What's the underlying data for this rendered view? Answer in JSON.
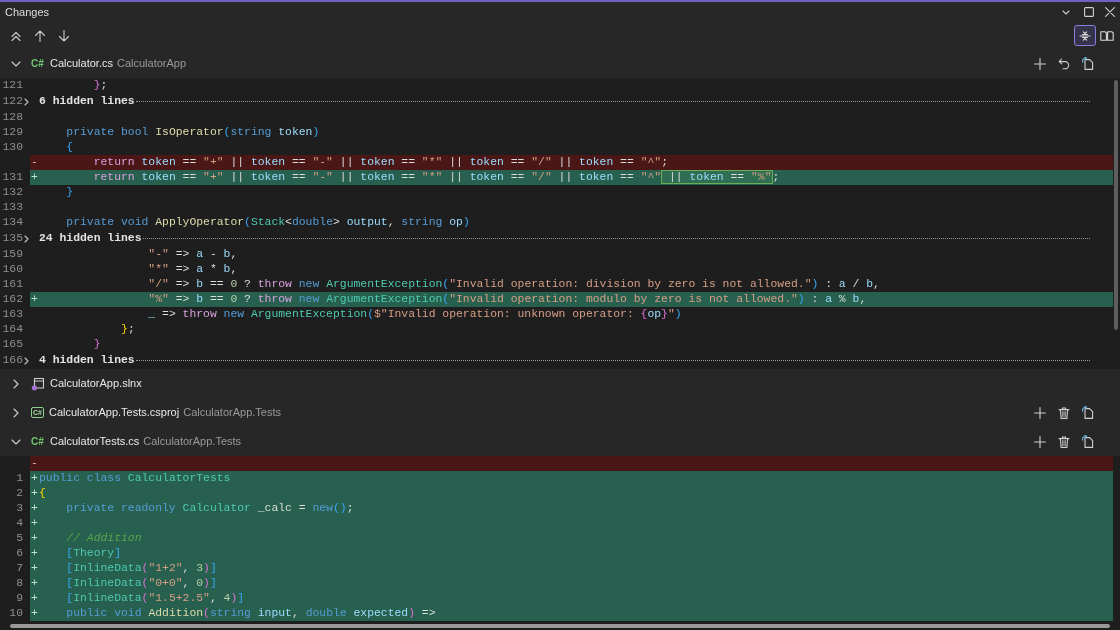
{
  "window": {
    "title": "Changes",
    "buttons": [
      {
        "kind": "dropdown"
      },
      {
        "kind": "maximize"
      },
      {
        "kind": "close"
      }
    ]
  },
  "toolbar": {
    "buttons": [
      {
        "kind": "first"
      },
      {
        "kind": "previous"
      },
      {
        "kind": "next"
      }
    ],
    "views": [
      {
        "kind": "inline",
        "selected": true
      },
      {
        "kind": "side-by-side",
        "selected": false
      }
    ]
  },
  "files": [
    {
      "name": "Calculator.cs",
      "project": "CalculatorApp",
      "icon": {
        "kind": "csharp",
        "text": "C#"
      },
      "expanded": true,
      "actions": [
        {
          "kind": "plus"
        },
        {
          "kind": "undo"
        },
        {
          "kind": "document"
        }
      ],
      "lines": [
        {
          "kind": "context",
          "number": "121",
          "tokens": [
            {
              "text": "        }",
              "kind": "brace2"
            },
            {
              "text": ";",
              "kind": "plain"
            }
          ]
        },
        {
          "kind": "hidden",
          "number": "122",
          "label": "6 hidden lines"
        },
        {
          "kind": "context",
          "number": "128"
        },
        {
          "kind": "context",
          "number": "129",
          "tokens": [
            {
              "text": "    private bool",
              "kind": "keyword"
            },
            {
              "text": " IsOperator",
              "kind": "method"
            },
            {
              "text": "(",
              "kind": "brace3"
            },
            {
              "text": "string",
              "kind": "keyword"
            },
            {
              "text": " token",
              "kind": "param"
            },
            {
              "text": ")",
              "kind": "brace3"
            }
          ]
        },
        {
          "kind": "context",
          "number": "130",
          "tokens": [
            {
              "text": "    {",
              "kind": "brace3"
            }
          ]
        },
        {
          "kind": "removed",
          "marker": "-",
          "tokens": [
            {
              "text": "        return",
              "kind": "control"
            },
            {
              "text": " token",
              "kind": "param"
            },
            {
              "text": " == ",
              "kind": "plain"
            },
            {
              "text": "\"+\"",
              "kind": "string"
            },
            {
              "text": " || ",
              "kind": "plain"
            },
            {
              "text": "token",
              "kind": "param"
            },
            {
              "text": " == ",
              "kind": "plain"
            },
            {
              "text": "\"-\"",
              "kind": "string"
            },
            {
              "text": " || ",
              "kind": "plain"
            },
            {
              "text": "token",
              "kind": "param"
            },
            {
              "text": " == ",
              "kind": "plain"
            },
            {
              "text": "\"*\"",
              "kind": "string"
            },
            {
              "text": " || ",
              "kind": "plain"
            },
            {
              "text": "token",
              "kind": "param"
            },
            {
              "text": " == ",
              "kind": "plain"
            },
            {
              "text": "\"/\"",
              "kind": "string"
            },
            {
              "text": " || ",
              "kind": "plain"
            },
            {
              "text": "token",
              "kind": "param"
            },
            {
              "text": " == ",
              "kind": "plain"
            },
            {
              "text": "\"^\"",
              "kind": "string"
            },
            {
              "text": ";",
              "kind": "plain"
            }
          ]
        },
        {
          "kind": "added",
          "number": "131",
          "marker": "+",
          "tokens": [
            {
              "text": "        return",
              "kind": "control"
            },
            {
              "text": " token",
              "kind": "param"
            },
            {
              "text": " == ",
              "kind": "plain"
            },
            {
              "text": "\"+\"",
              "kind": "string"
            },
            {
              "text": " || ",
              "kind": "plain"
            },
            {
              "text": "token",
              "kind": "param"
            },
            {
              "text": " == ",
              "kind": "plain"
            },
            {
              "text": "\"-\"",
              "kind": "string"
            },
            {
              "text": " || ",
              "kind": "plain"
            },
            {
              "text": "token",
              "kind": "param"
            },
            {
              "text": " == ",
              "kind": "plain"
            },
            {
              "text": "\"*\"",
              "kind": "string"
            },
            {
              "text": " || ",
              "kind": "plain"
            },
            {
              "text": "token",
              "kind": "param"
            },
            {
              "text": " == ",
              "kind": "plain"
            },
            {
              "text": "\"/\"",
              "kind": "string"
            },
            {
              "text": " || ",
              "kind": "plain"
            },
            {
              "text": "token",
              "kind": "param"
            },
            {
              "text": " == ",
              "kind": "plain"
            },
            {
              "text": "\"^\"",
              "kind": "string"
            },
            {
              "kind": "change",
              "tokens": [
                {
                  "text": " || ",
                  "kind": "plain"
                },
                {
                  "text": "token",
                  "kind": "param"
                },
                {
                  "text": " == ",
                  "kind": "plain"
                },
                {
                  "text": "\"%\"",
                  "kind": "string"
                }
              ]
            },
            {
              "text": ";",
              "kind": "plain"
            }
          ]
        },
        {
          "kind": "context",
          "number": "132",
          "tokens": [
            {
              "text": "    }",
              "kind": "brace3"
            }
          ]
        },
        {
          "kind": "context",
          "number": "133"
        },
        {
          "kind": "context",
          "number": "134",
          "tokens": [
            {
              "text": "    private void",
              "kind": "keyword"
            },
            {
              "text": " ApplyOperator",
              "kind": "method"
            },
            {
              "text": "(",
              "kind": "brace3"
            },
            {
              "text": "Stack",
              "kind": "type"
            },
            {
              "text": "<",
              "kind": "plain"
            },
            {
              "text": "double",
              "kind": "keyword"
            },
            {
              "text": ">",
              "kind": "plain"
            },
            {
              "text": " output",
              "kind": "param"
            },
            {
              "text": ", ",
              "kind": "plain"
            },
            {
              "text": "string",
              "kind": "keyword"
            },
            {
              "text": " op",
              "kind": "param"
            },
            {
              "text": ")",
              "kind": "brace3"
            }
          ]
        },
        {
          "kind": "hidden",
          "number": "135",
          "label": "24 hidden lines"
        },
        {
          "kind": "context",
          "number": "159",
          "tokens": [
            {
              "text": "                \"-\"",
              "kind": "string"
            },
            {
              "text": " => ",
              "kind": "plain"
            },
            {
              "text": "a",
              "kind": "param"
            },
            {
              "text": " - ",
              "kind": "plain"
            },
            {
              "text": "b",
              "kind": "param"
            },
            {
              "text": ",",
              "kind": "plain"
            }
          ]
        },
        {
          "kind": "context",
          "number": "160",
          "tokens": [
            {
              "text": "                \"*\"",
              "kind": "string"
            },
            {
              "text": " => ",
              "kind": "plain"
            },
            {
              "text": "a",
              "kind": "param"
            },
            {
              "text": " * ",
              "kind": "plain"
            },
            {
              "text": "b",
              "kind": "param"
            },
            {
              "text": ",",
              "kind": "plain"
            }
          ]
        },
        {
          "kind": "context",
          "number": "161",
          "tokens": [
            {
              "text": "                \"/\"",
              "kind": "string"
            },
            {
              "text": " => ",
              "kind": "plain"
            },
            {
              "text": "b",
              "kind": "param"
            },
            {
              "text": " == ",
              "kind": "plain"
            },
            {
              "text": "0",
              "kind": "number"
            },
            {
              "text": " ? ",
              "kind": "plain"
            },
            {
              "text": "throw",
              "kind": "control"
            },
            {
              "text": " new",
              "kind": "keyword"
            },
            {
              "text": " ArgumentException",
              "kind": "type"
            },
            {
              "text": "(",
              "kind": "brace3"
            },
            {
              "text": "\"Invalid operation: division by zero is not allowed.\"",
              "kind": "string"
            },
            {
              "text": ")",
              "kind": "brace3"
            },
            {
              "text": " : ",
              "kind": "plain"
            },
            {
              "text": "a",
              "kind": "param"
            },
            {
              "text": " / ",
              "kind": "plain"
            },
            {
              "text": "b",
              "kind": "param"
            },
            {
              "text": ",",
              "kind": "plain"
            }
          ]
        },
        {
          "kind": "added",
          "number": "162",
          "marker": "+",
          "tokens": [
            {
              "text": "                \"%\"",
              "kind": "string"
            },
            {
              "text": " => ",
              "kind": "plain"
            },
            {
              "text": "b",
              "kind": "param"
            },
            {
              "text": " == ",
              "kind": "plain"
            },
            {
              "text": "0",
              "kind": "number"
            },
            {
              "text": " ? ",
              "kind": "plain"
            },
            {
              "text": "throw",
              "kind": "control"
            },
            {
              "text": " new",
              "kind": "keyword"
            },
            {
              "text": " ArgumentException",
              "kind": "type"
            },
            {
              "text": "(",
              "kind": "brace3"
            },
            {
              "text": "\"Invalid operation: modulo by zero is not allowed.\"",
              "kind": "string"
            },
            {
              "text": ")",
              "kind": "brace3"
            },
            {
              "text": " : ",
              "kind": "plain"
            },
            {
              "text": "a",
              "kind": "param"
            },
            {
              "text": " % ",
              "kind": "plain"
            },
            {
              "text": "b",
              "kind": "param"
            },
            {
              "text": ",",
              "kind": "plain"
            }
          ]
        },
        {
          "kind": "context",
          "number": "163",
          "tokens": [
            {
              "text": "                _",
              "kind": "param"
            },
            {
              "text": " => ",
              "kind": "plain"
            },
            {
              "text": "throw",
              "kind": "control"
            },
            {
              "text": " new",
              "kind": "keyword"
            },
            {
              "text": " ArgumentException",
              "kind": "type"
            },
            {
              "text": "(",
              "kind": "brace3"
            },
            {
              "text": "$\"Invalid operation: unknown operator: ",
              "kind": "string"
            },
            {
              "text": "{",
              "kind": "brace2"
            },
            {
              "text": "op",
              "kind": "param"
            },
            {
              "text": "}",
              "kind": "brace2"
            },
            {
              "text": "\"",
              "kind": "string"
            },
            {
              "text": ")",
              "kind": "brace3"
            }
          ]
        },
        {
          "kind": "context",
          "number": "164",
          "tokens": [
            {
              "text": "            }",
              "kind": "brace1"
            },
            {
              "text": ";",
              "kind": "plain"
            }
          ]
        },
        {
          "kind": "context",
          "number": "165",
          "tokens": [
            {
              "text": "        }",
              "kind": "brace2"
            }
          ]
        },
        {
          "kind": "hidden",
          "number": "166",
          "label": "4 hidden lines"
        }
      ]
    },
    {
      "name": "CalculatorApp.slnx",
      "icon": {
        "kind": "solution"
      },
      "expanded": false
    },
    {
      "name": "CalculatorApp.Tests.csproj",
      "project": "CalculatorApp.Tests",
      "icon": {
        "kind": "project",
        "text": "C#"
      },
      "expanded": false,
      "actions": [
        {
          "kind": "plus"
        },
        {
          "kind": "trash"
        },
        {
          "kind": "document"
        }
      ]
    },
    {
      "name": "CalculatorTests.cs",
      "project": "CalculatorApp.Tests",
      "icon": {
        "kind": "csharp",
        "text": "C#"
      },
      "expanded": true,
      "actions": [
        {
          "kind": "plus"
        },
        {
          "kind": "trash"
        },
        {
          "kind": "document"
        }
      ],
      "lines": [
        {
          "kind": "removed",
          "marker": "-"
        },
        {
          "kind": "added",
          "number": "1",
          "marker": "+",
          "tokens": [
            {
              "text": "public class",
              "kind": "keyword"
            },
            {
              "text": " CalculatorTests",
              "kind": "type"
            }
          ]
        },
        {
          "kind": "added",
          "number": "2",
          "marker": "+",
          "tokens": [
            {
              "text": "{",
              "kind": "brace1"
            }
          ]
        },
        {
          "kind": "added",
          "number": "3",
          "marker": "+",
          "tokens": [
            {
              "text": "    private readonly",
              "kind": "keyword"
            },
            {
              "text": " Calculator",
              "kind": "type"
            },
            {
              "text": " _calc",
              "kind": "plain"
            },
            {
              "text": " = ",
              "kind": "plain"
            },
            {
              "text": "new",
              "kind": "keyword"
            },
            {
              "text": "()",
              "kind": "brace3"
            },
            {
              "text": ";",
              "kind": "plain"
            }
          ]
        },
        {
          "kind": "added",
          "number": "4",
          "marker": "+"
        },
        {
          "kind": "added",
          "number": "5",
          "marker": "+",
          "tokens": [
            {
              "text": "    // Addition",
              "kind": "comment"
            }
          ]
        },
        {
          "kind": "added",
          "number": "6",
          "marker": "+",
          "tokens": [
            {
              "text": "    [",
              "kind": "brace3"
            },
            {
              "text": "Theory",
              "kind": "type"
            },
            {
              "text": "]",
              "kind": "brace3"
            }
          ]
        },
        {
          "kind": "added",
          "number": "7",
          "marker": "+",
          "tokens": [
            {
              "text": "    [",
              "kind": "brace3"
            },
            {
              "text": "InlineData",
              "kind": "type"
            },
            {
              "text": "(",
              "kind": "brace2"
            },
            {
              "text": "\"1+2\"",
              "kind": "string"
            },
            {
              "text": ", ",
              "kind": "plain"
            },
            {
              "text": "3",
              "kind": "number"
            },
            {
              "text": ")",
              "kind": "brace2"
            },
            {
              "text": "]",
              "kind": "brace3"
            }
          ]
        },
        {
          "kind": "added",
          "number": "8",
          "marker": "+",
          "tokens": [
            {
              "text": "    [",
              "kind": "brace3"
            },
            {
              "text": "InlineData",
              "kind": "type"
            },
            {
              "text": "(",
              "kind": "brace2"
            },
            {
              "text": "\"0+0\"",
              "kind": "string"
            },
            {
              "text": ", ",
              "kind": "plain"
            },
            {
              "text": "0",
              "kind": "number"
            },
            {
              "text": ")",
              "kind": "brace2"
            },
            {
              "text": "]",
              "kind": "brace3"
            }
          ]
        },
        {
          "kind": "added",
          "number": "9",
          "marker": "+",
          "tokens": [
            {
              "text": "    [",
              "kind": "brace3"
            },
            {
              "text": "InlineData",
              "kind": "type"
            },
            {
              "text": "(",
              "kind": "brace2"
            },
            {
              "text": "\"1.5+2.5\"",
              "kind": "string"
            },
            {
              "text": ", ",
              "kind": "plain"
            },
            {
              "text": "4",
              "kind": "number"
            },
            {
              "text": ")",
              "kind": "brace2"
            },
            {
              "text": "]",
              "kind": "brace3"
            }
          ]
        },
        {
          "kind": "added",
          "number": "10",
          "marker": "+",
          "tokens": [
            {
              "text": "    public void",
              "kind": "keyword"
            },
            {
              "text": " Addition",
              "kind": "method"
            },
            {
              "text": "(",
              "kind": "brace2"
            },
            {
              "text": "string",
              "kind": "keyword"
            },
            {
              "text": " input",
              "kind": "param"
            },
            {
              "text": ", ",
              "kind": "plain"
            },
            {
              "text": "double",
              "kind": "keyword"
            },
            {
              "text": " expected",
              "kind": "param"
            },
            {
              "text": ")",
              "kind": "brace2"
            },
            {
              "text": " =>",
              "kind": "plain"
            }
          ]
        }
      ]
    }
  ]
}
